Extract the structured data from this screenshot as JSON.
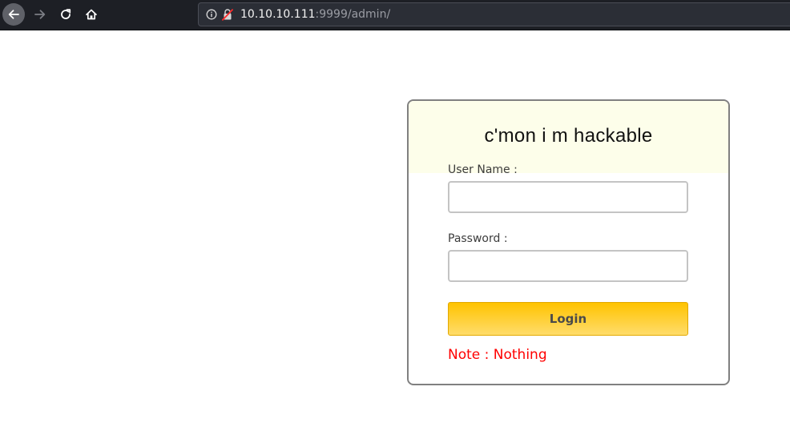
{
  "browser": {
    "url_host": "10.10.10.111",
    "url_rest": ":9999/admin/",
    "icons": {
      "back": "arrow-left-icon",
      "forward": "arrow-right-icon",
      "reload": "reload-icon",
      "home": "home-icon",
      "info": "info-icon",
      "lock": "insecure-lock-icon"
    }
  },
  "login_form": {
    "title": "c'mon i m hackable",
    "username_label": "User Name :",
    "username_value": "",
    "password_label": "Password :",
    "password_value": "",
    "login_button": "Login",
    "note": "Note : Nothing"
  },
  "colors": {
    "toolbar_bg": "#1d1f25",
    "card_header_bg": "#fdfeea",
    "button_gradient_top": "#ffc300",
    "button_gradient_bottom": "#ffdc6b",
    "note_text": "#ff0000"
  }
}
